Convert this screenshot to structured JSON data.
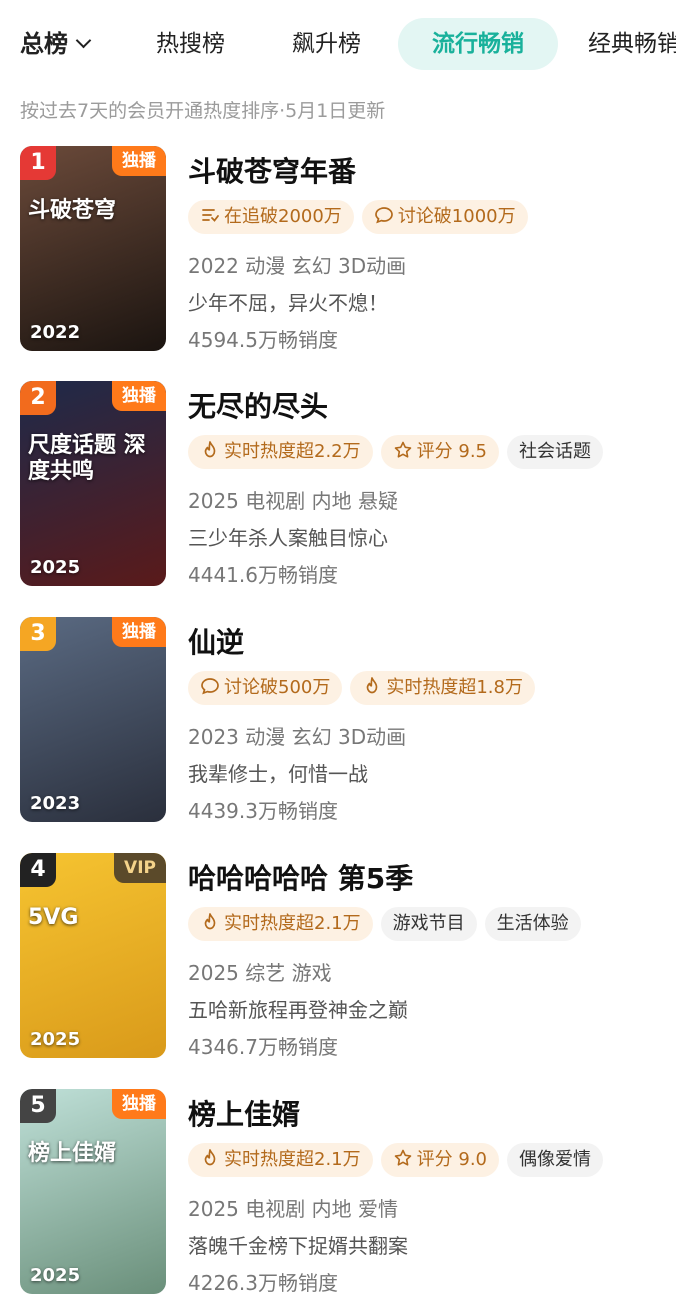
{
  "tabs": {
    "total": "总榜",
    "hot_search": "热搜榜",
    "rising": "飙升榜",
    "popular": "流行畅销",
    "classic": "经典畅销"
  },
  "subtitle": "按过去7天的会员开通热度排序·5月1日更新",
  "items": [
    {
      "rank": "1",
      "badge": "独播",
      "year": "2022",
      "poster_mark": "斗破苍穹",
      "title": "斗破苍穹年番",
      "tags": [
        {
          "icon": "follow-list-icon",
          "text": "在追破2000万",
          "style": "hot"
        },
        {
          "icon": "chat-bubble-icon",
          "text": "讨论破1000万",
          "style": "hot"
        }
      ],
      "meta": "2022 动漫 玄幻 3D动画",
      "slogan": "少年不屈，异火不熄！",
      "sales": "4594.5万畅销度",
      "colors": {
        "rank": "#e53935",
        "art_top": "#6b4a3a",
        "art_bottom": "#1b1410"
      }
    },
    {
      "rank": "2",
      "badge": "独播",
      "year": "2025",
      "poster_mark": "尺度话题 深度共鸣",
      "title": "无尽的尽头",
      "tags": [
        {
          "icon": "flame-icon",
          "text": "实时热度超2.2万",
          "style": "hot"
        },
        {
          "icon": "star-icon",
          "text": "评分 9.5",
          "style": "hot"
        },
        {
          "icon": "",
          "text": "社会话题",
          "style": "plain"
        }
      ],
      "meta": "2025 电视剧 内地 悬疑",
      "slogan": "三少年杀人案触目惊心",
      "sales": "4441.6万畅销度",
      "colors": {
        "rank": "#f26b1d",
        "art_top": "#1e2a4a",
        "art_bottom": "#5a1a1a"
      }
    },
    {
      "rank": "3",
      "badge": "独播",
      "year": "2023",
      "poster_mark": "",
      "title": "仙逆",
      "tags": [
        {
          "icon": "chat-bubble-icon",
          "text": "讨论破500万",
          "style": "hot"
        },
        {
          "icon": "flame-icon",
          "text": "实时热度超1.8万",
          "style": "hot"
        }
      ],
      "meta": "2023 动漫 玄幻 3D动画",
      "slogan": "我辈修士，何惜一战",
      "sales": "4439.3万畅销度",
      "colors": {
        "rank": "#f5a623",
        "art_top": "#5a6a82",
        "art_bottom": "#2a2f3c"
      }
    },
    {
      "rank": "4",
      "badge": "VIP",
      "year": "2025",
      "poster_mark": "5VG",
      "title": "哈哈哈哈哈 第5季",
      "tags": [
        {
          "icon": "flame-icon",
          "text": "实时热度超2.1万",
          "style": "hot"
        },
        {
          "icon": "",
          "text": "游戏节目",
          "style": "plain"
        },
        {
          "icon": "",
          "text": "生活体验",
          "style": "plain"
        }
      ],
      "meta": "2025 综艺 游戏",
      "slogan": "五哈新旅程再登神金之巅",
      "sales": "4346.7万畅销度",
      "colors": {
        "rank": "#222222",
        "art_top": "#f6c431",
        "art_bottom": "#d99a1a"
      }
    },
    {
      "rank": "5",
      "badge": "独播",
      "year": "2025",
      "poster_mark": "榜上佳婿",
      "title": "榜上佳婿",
      "tags": [
        {
          "icon": "flame-icon",
          "text": "实时热度超2.1万",
          "style": "hot"
        },
        {
          "icon": "star-icon",
          "text": "评分 9.0",
          "style": "hot"
        },
        {
          "icon": "",
          "text": "偶像爱情",
          "style": "plain"
        }
      ],
      "meta": "2025 电视剧 内地 爱情",
      "slogan": "落魄千金榜下捉婿共翻案",
      "sales": "4226.3万畅销度",
      "colors": {
        "rank": "#444444",
        "art_top": "#bfe0d8",
        "art_bottom": "#6a8f7a"
      }
    }
  ]
}
